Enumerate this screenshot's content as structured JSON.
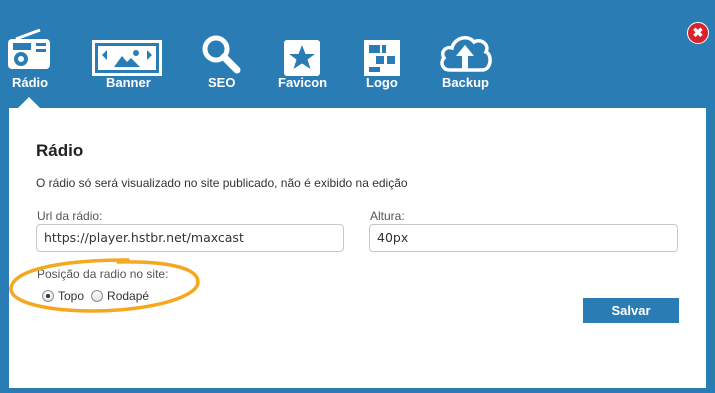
{
  "toolbar": {
    "tabs": [
      {
        "label": "Rádio",
        "icon": "radio-icon"
      },
      {
        "label": "Banner",
        "icon": "banner-icon"
      },
      {
        "label": "SEO",
        "icon": "magnifier-icon"
      },
      {
        "label": "Favicon",
        "icon": "star-icon"
      },
      {
        "label": "Logo",
        "icon": "logo-blocks-icon"
      },
      {
        "label": "Backup",
        "icon": "cloud-upload-icon"
      }
    ],
    "active_tab": "Rádio",
    "close_label": "✖"
  },
  "panel": {
    "title": "Rádio",
    "description": "O rádio só será visualizado no site publicado, não é exibido na edição",
    "url_label": "Url da rádio:",
    "url_value": "https://player.hstbr.net/maxcast",
    "height_label": "Altura:",
    "height_value": "40px",
    "position_label": "Posição da radio no site:",
    "position_options": [
      "Topo",
      "Rodapé"
    ],
    "position_selected": "Topo",
    "save_label": "Salvar"
  },
  "colors": {
    "toolbar_bg": "#2a7db4",
    "save_button": "#2a7db4",
    "close_button": "#d9232c",
    "annotation": "#f5a81f"
  }
}
